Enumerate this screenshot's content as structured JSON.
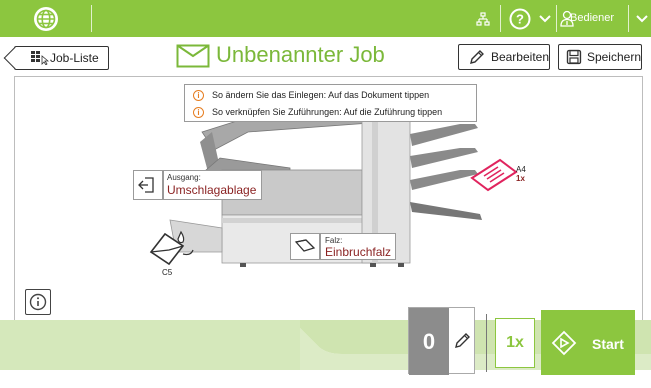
{
  "topbar": {
    "user_label": "Bediener"
  },
  "header": {
    "job_list_label": "Job-Liste",
    "title": "Unbenannter Job",
    "edit_label": "Bearbeiten",
    "save_label": "Speichern"
  },
  "info": {
    "line1": "So ändern Sie das Einlegen: Auf das Dokument tippen",
    "line2": "So verknüpfen Sie Zuführungen: Auf die Zuführung tippen"
  },
  "output": {
    "caption": "Ausgang:",
    "value": "Umschlagablage"
  },
  "fold": {
    "caption": "Falz:",
    "value": "Einbruchfalz"
  },
  "insert": {
    "format": "A4",
    "count": "1x"
  },
  "envelope": {
    "format": "C5"
  },
  "footer": {
    "counter_value": "0",
    "multiplier_label": "1x",
    "start_label": "Start"
  },
  "colors": {
    "brand": "#8cc63f",
    "accent_text": "#8b2323",
    "highlight": "#e0245e",
    "warning": "#e67e22"
  }
}
